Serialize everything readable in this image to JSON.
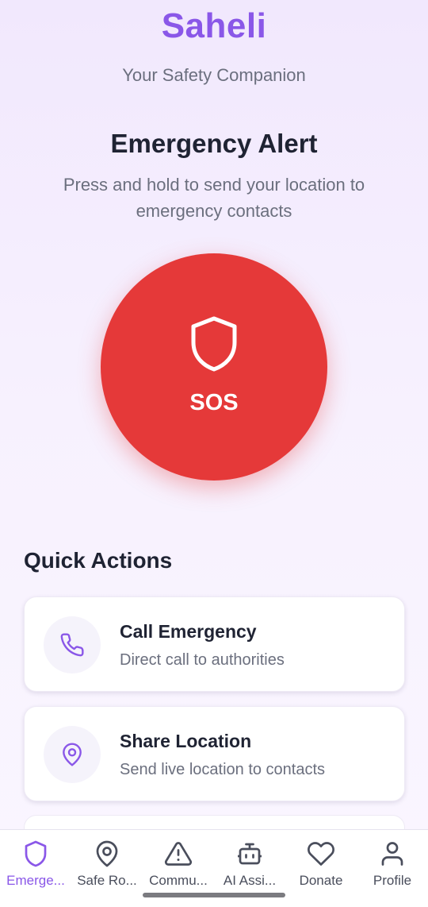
{
  "header": {
    "title": "Saheli",
    "subtitle": "Your Safety Companion"
  },
  "alert": {
    "title": "Emergency Alert",
    "description": "Press and hold to send your location to emergency contacts",
    "sos_label": "SOS",
    "sos_icon": "shield-icon"
  },
  "quick_actions": {
    "title": "Quick Actions",
    "items": [
      {
        "icon": "phone-icon",
        "title": "Call Emergency",
        "subtitle": "Direct call to authorities"
      },
      {
        "icon": "location-pin-icon",
        "title": "Share Location",
        "subtitle": "Send live location to contacts"
      }
    ]
  },
  "nav": {
    "items": [
      {
        "icon": "shield-icon",
        "label": "Emerge...",
        "active": true
      },
      {
        "icon": "location-pin-icon",
        "label": "Safe Ro..."
      },
      {
        "icon": "warning-triangle-icon",
        "label": "Commu..."
      },
      {
        "icon": "robot-icon",
        "label": "AI Assi..."
      },
      {
        "icon": "heart-icon",
        "label": "Donate"
      },
      {
        "icon": "person-icon",
        "label": "Profile"
      }
    ]
  },
  "colors": {
    "brand": "#8a57e8",
    "sos": "#e53939",
    "text": "#1f2333",
    "muted": "#6b6f7e"
  }
}
